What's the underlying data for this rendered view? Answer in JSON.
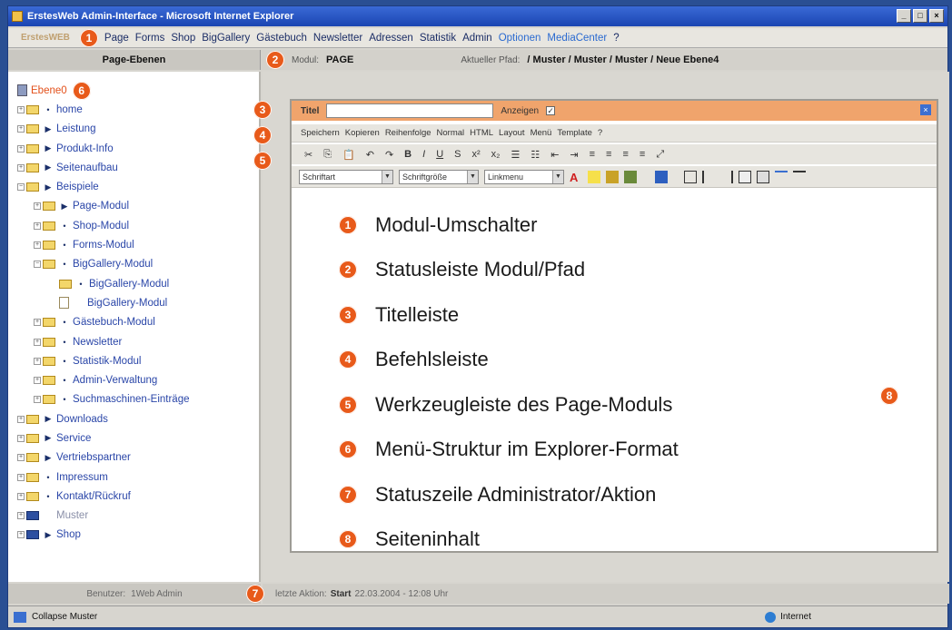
{
  "window": {
    "title": "ErstesWeb Admin-Interface - Microsoft Internet Explorer",
    "buttons": [
      "_",
      "□",
      "×"
    ]
  },
  "menubar": {
    "logo": "ErstesWEB",
    "items": [
      "Page",
      "Forms",
      "Shop",
      "BigGallery",
      "Gästebuch",
      "Newsletter",
      "Adressen",
      "Statistik",
      "Admin",
      "Optionen",
      "MediaCenter",
      "?"
    ]
  },
  "statusrow": {
    "left_title": "Page-Ebenen",
    "modul_label": "Modul:",
    "modul_value": "PAGE",
    "path_label": "Aktueller Pfad:",
    "path_value": "/ Muster / Muster / Muster / Neue Ebene4"
  },
  "badges": {
    "b1": "1",
    "b2": "2",
    "b3": "3",
    "b4": "4",
    "b5": "5",
    "b6": "6",
    "b7": "7",
    "b8": "8"
  },
  "tree": {
    "root": "Ebene0",
    "items": [
      {
        "label": "home",
        "mark": "•",
        "pm": "+"
      },
      {
        "label": "Leistung",
        "mark": "▶",
        "pm": "+"
      },
      {
        "label": "Produkt-Info",
        "mark": "▶",
        "pm": "+"
      },
      {
        "label": "Seitenaufbau",
        "mark": "▶",
        "pm": "+"
      },
      {
        "label": "Beispiele",
        "mark": "▶",
        "pm": "−"
      },
      {
        "label": "Page-Modul",
        "mark": "▶",
        "pm": "+"
      },
      {
        "label": "Shop-Modul",
        "mark": "•",
        "pm": "+"
      },
      {
        "label": "Forms-Modul",
        "mark": "•",
        "pm": "+"
      },
      {
        "label": "BigGallery-Modul",
        "mark": "•",
        "pm": "−"
      },
      {
        "label": "BigGallery-Modul",
        "mark": "•",
        "pm": ""
      },
      {
        "label": "BigGallery-Modul",
        "mark": "",
        "pm": ""
      },
      {
        "label": "Gästebuch-Modul",
        "mark": "•",
        "pm": "+"
      },
      {
        "label": "Newsletter",
        "mark": "•",
        "pm": "+"
      },
      {
        "label": "Statistik-Modul",
        "mark": "•",
        "pm": "+"
      },
      {
        "label": "Admin-Verwaltung",
        "mark": "•",
        "pm": "+"
      },
      {
        "label": "Suchmaschinen-Einträge",
        "mark": "•",
        "pm": "+"
      },
      {
        "label": "Downloads",
        "mark": "▶",
        "pm": "+"
      },
      {
        "label": "Service",
        "mark": "▶",
        "pm": "+"
      },
      {
        "label": "Vertriebspartner",
        "mark": "▶",
        "pm": "+"
      },
      {
        "label": "Impressum",
        "mark": "•",
        "pm": "+"
      },
      {
        "label": "Kontakt/Rückruf",
        "mark": "•",
        "pm": "+"
      },
      {
        "label": "Muster",
        "mark": "",
        "pm": "+"
      },
      {
        "label": "Shop",
        "mark": "▶",
        "pm": "+"
      }
    ]
  },
  "editor": {
    "title_label": "Titel",
    "title_value": "",
    "show_label": "Anzeigen",
    "show_checked": "✓",
    "close": "×",
    "commands": [
      "Speichern",
      "Kopieren",
      "Reihenfolge",
      "Normal",
      "HTML",
      "Layout",
      "Menü",
      "Template",
      "?"
    ],
    "tools": [
      "✂",
      "⎘",
      "📋",
      "↶",
      "↷",
      "B",
      "I",
      "U",
      "S",
      "x²",
      "x₂",
      "☰",
      "☷",
      "⇤",
      "⇥",
      "≡",
      "≡",
      "≡",
      "≡",
      "⤢"
    ],
    "font_select": "Schriftart",
    "size_select": "Schriftgröße",
    "link_select": "Linkmenu"
  },
  "legend": [
    {
      "num": "1",
      "text": "Modul-Umschalter"
    },
    {
      "num": "2",
      "text": "Statusleiste Modul/Pfad"
    },
    {
      "num": "3",
      "text": "Titelleiste"
    },
    {
      "num": "4",
      "text": "Befehlsleiste"
    },
    {
      "num": "5",
      "text": "Werkzeugleiste des Page-Moduls"
    },
    {
      "num": "6",
      "text": "Menü-Struktur im Explorer-Format"
    },
    {
      "num": "7",
      "text": "Statuszeile Administrator/Aktion"
    },
    {
      "num": "8",
      "text": "Seiteninhalt"
    }
  ],
  "footer": {
    "user_label": "Benutzer:",
    "user_value": "1Web Admin",
    "action_label": "letzte Aktion:",
    "action_value": "Start",
    "action_date": "22.03.2004 - 12:08 Uhr"
  },
  "browser_status": {
    "left": "Collapse Muster",
    "zone": "Internet"
  },
  "colors": {
    "accent": "#e85a1a",
    "titlebar": "#1b45b2",
    "editor_title": "#f0a46c"
  }
}
